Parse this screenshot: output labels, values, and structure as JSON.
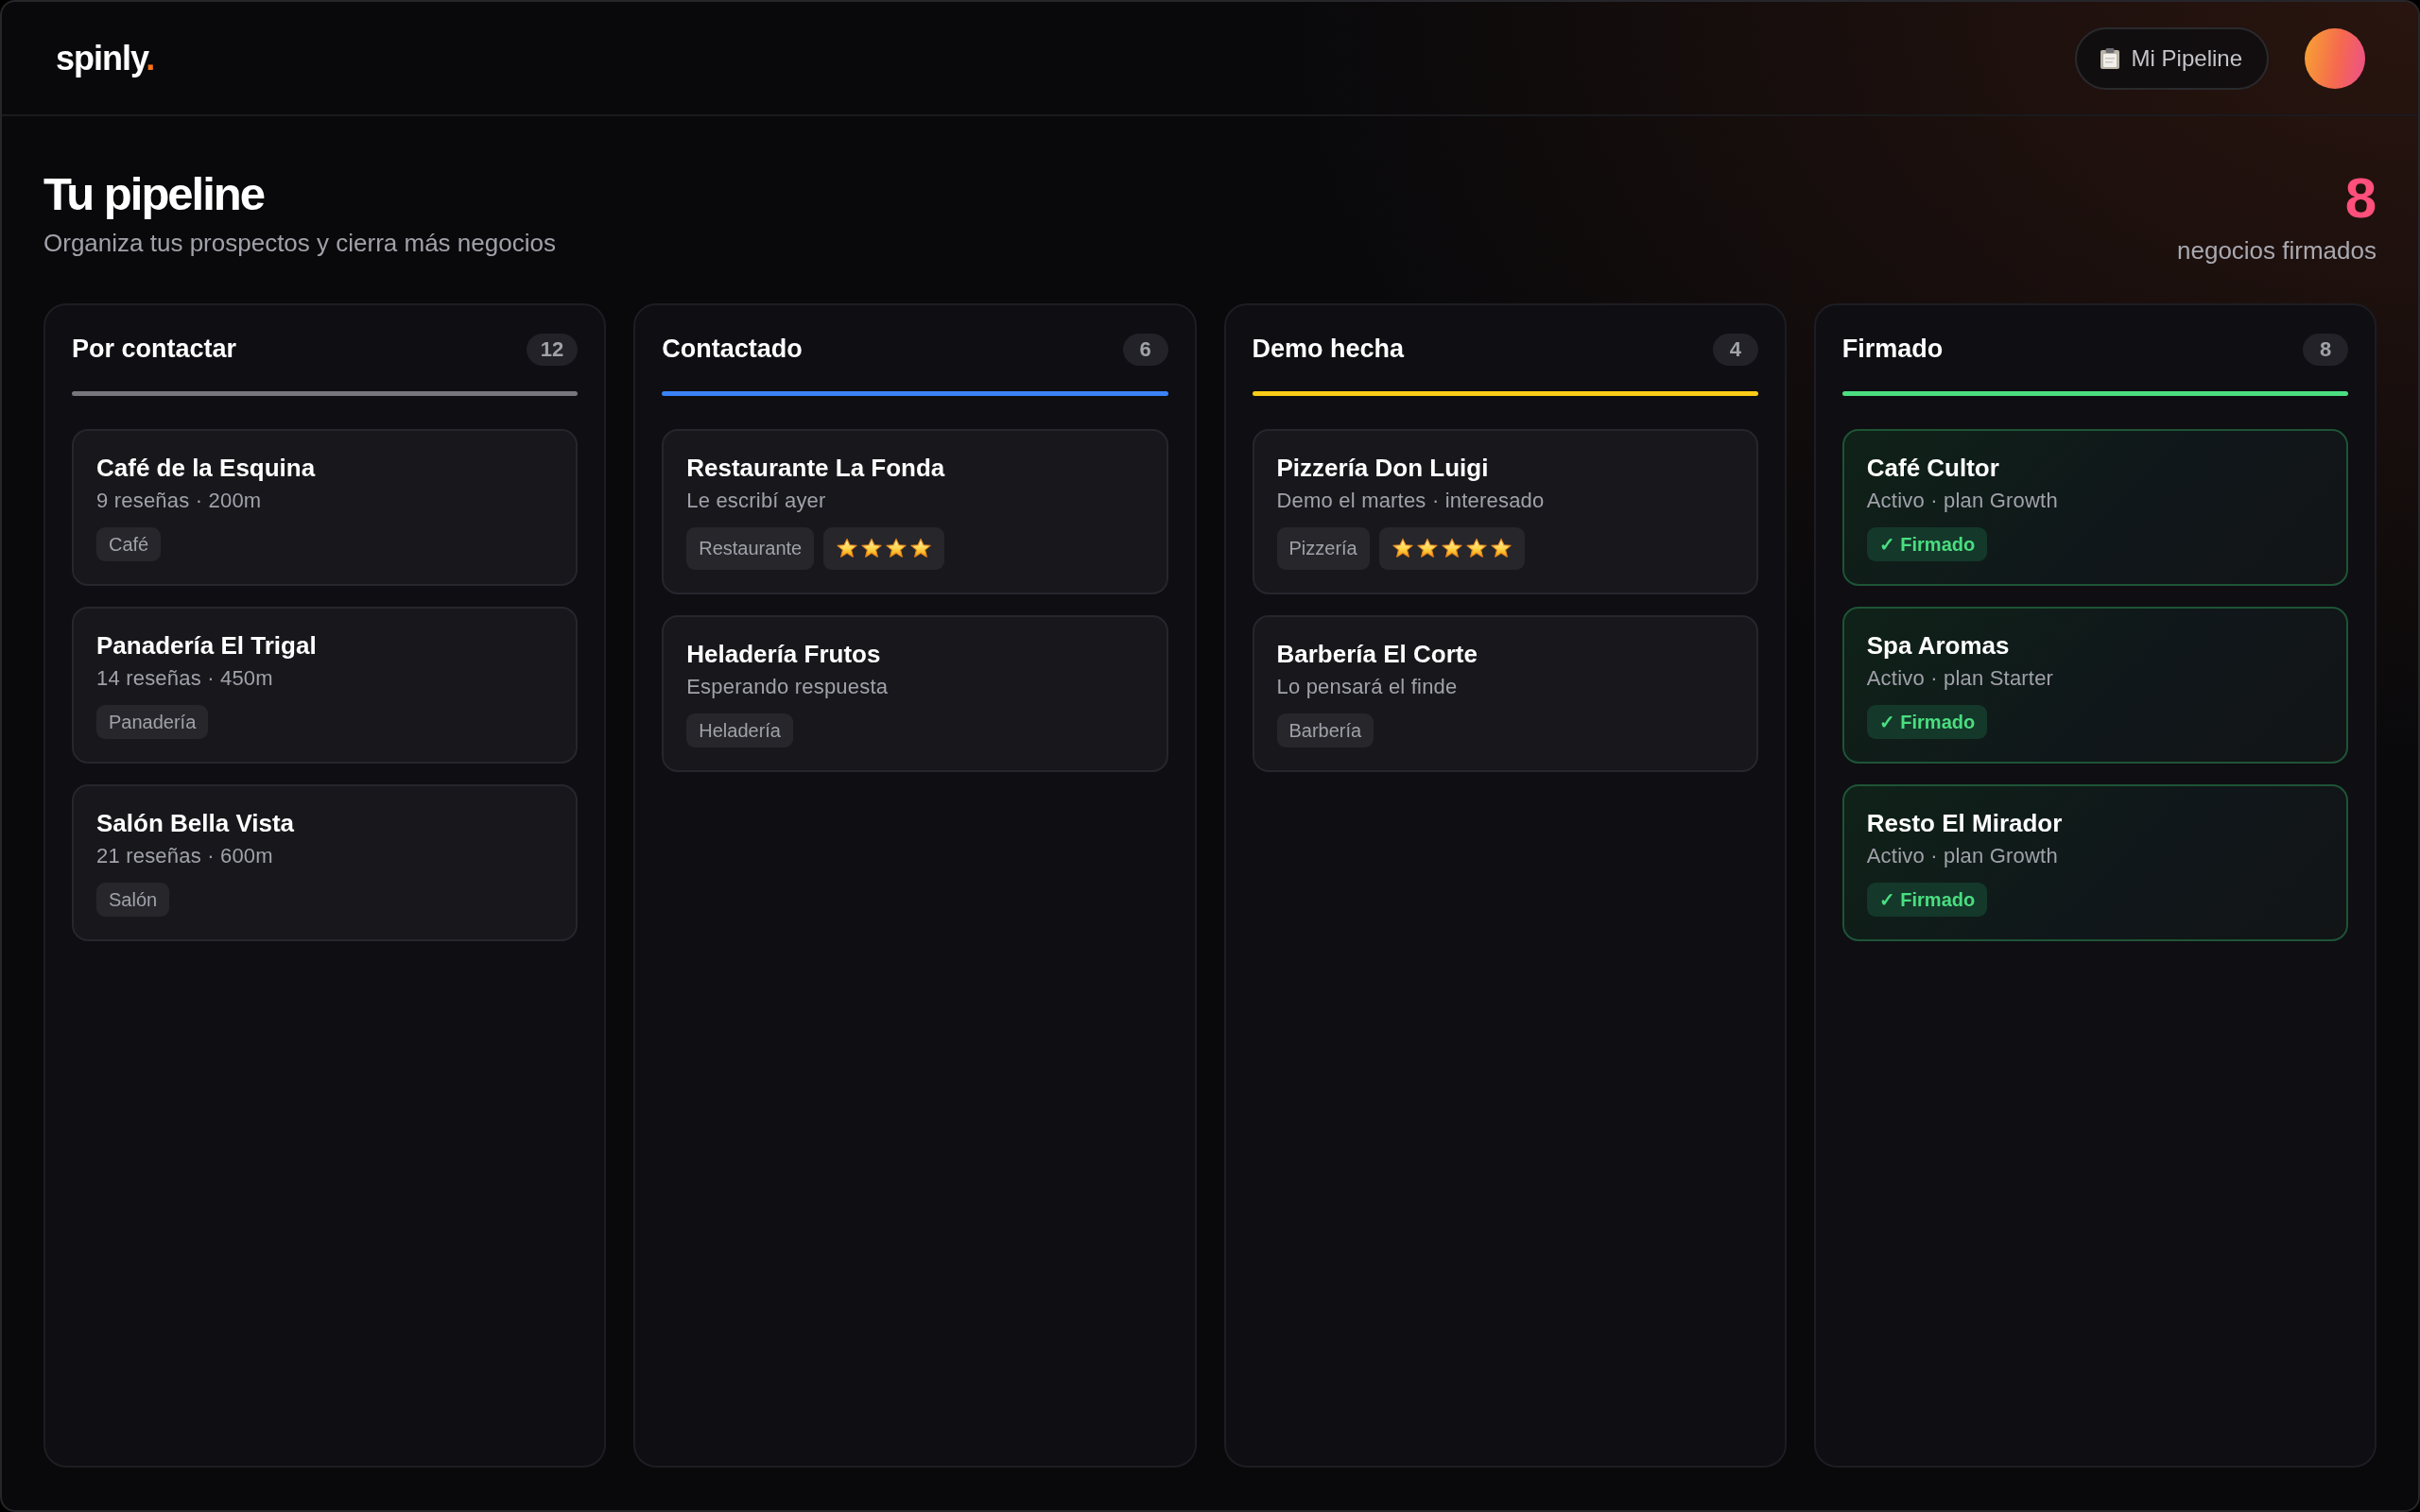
{
  "header": {
    "logo": {
      "text": "spinly",
      "mark": "."
    },
    "pipeline_button": {
      "label": "Mi Pipeline"
    }
  },
  "page": {
    "title": "Tu pipeline",
    "subtitle": "Organiza tus prospectos y cierra más negocios",
    "signed": {
      "count": "8",
      "label": "negocios firmados"
    }
  },
  "columns": [
    {
      "title": "Por contactar",
      "count": "12",
      "color": "#76767c",
      "cards": [
        {
          "kind": "prospect",
          "name": "Café de la Esquina",
          "detail": "9 reseñas · 200m",
          "tag": "Café"
        },
        {
          "kind": "prospect",
          "name": "Panadería El Trigal",
          "detail": "14 reseñas · 450m",
          "tag": "Panadería"
        },
        {
          "kind": "prospect",
          "name": "Salón Bella Vista",
          "detail": "21 reseñas · 600m",
          "tag": "Salón"
        }
      ]
    },
    {
      "title": "Contactado",
      "count": "6",
      "color": "#3b82f6",
      "cards": [
        {
          "kind": "prospect",
          "name": "Restaurante La Fonda",
          "detail": "Le escribí ayer",
          "tag": "Restaurante",
          "stars": 4
        },
        {
          "kind": "prospect",
          "name": "Heladería Frutos",
          "detail": "Esperando respuesta",
          "tag": "Heladería"
        }
      ]
    },
    {
      "title": "Demo hecha",
      "count": "4",
      "color": "#facc15",
      "cards": [
        {
          "kind": "prospect",
          "name": "Pizzería Don Luigi",
          "detail": "Demo el martes · interesado",
          "tag": "Pizzería",
          "stars": 5
        },
        {
          "kind": "prospect",
          "name": "Barbería El Corte",
          "detail": "Lo pensará el finde",
          "tag": "Barbería"
        }
      ]
    },
    {
      "title": "Firmado",
      "count": "8",
      "color": "#4ade80",
      "cards": [
        {
          "kind": "signed",
          "name": "Café Cultor",
          "detail": "Activo · plan Growth",
          "tag": "✓ Firmado"
        },
        {
          "kind": "signed",
          "name": "Spa Aromas",
          "detail": "Activo · plan Starter",
          "tag": "✓ Firmado"
        },
        {
          "kind": "signed",
          "name": "Resto El Mirador",
          "detail": "Activo · plan Growth",
          "tag": "✓ Firmado"
        }
      ]
    }
  ]
}
